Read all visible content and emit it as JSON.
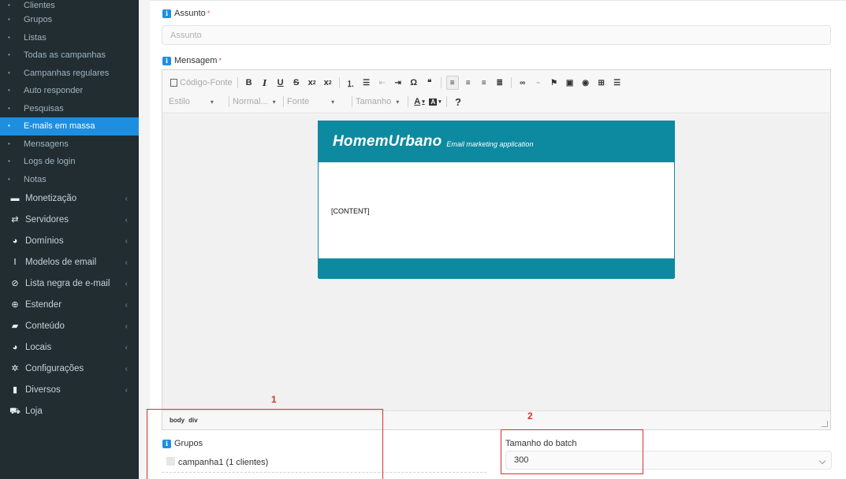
{
  "sidebar": {
    "sub_items": [
      {
        "label": "Clientes"
      },
      {
        "label": "Grupos"
      },
      {
        "label": "Listas"
      },
      {
        "label": "Todas as campanhas"
      },
      {
        "label": "Campanhas regulares"
      },
      {
        "label": "Auto responder"
      },
      {
        "label": "Pesquisas"
      },
      {
        "label": "E-mails em massa",
        "active": true
      },
      {
        "label": "Mensagens"
      },
      {
        "label": "Logs de login"
      },
      {
        "label": "Notas"
      }
    ],
    "main_items": [
      {
        "label": "Monetização",
        "icon": "credit-card-icon",
        "glyph": "▬",
        "chevron": "‹"
      },
      {
        "label": "Servidores",
        "icon": "exchange-icon",
        "glyph": "⇄",
        "chevron": "‹"
      },
      {
        "label": "Domínios",
        "icon": "globe-icon",
        "glyph": "◕",
        "chevron": "‹"
      },
      {
        "label": "Modelos de email",
        "icon": "text-height-icon",
        "glyph": "Ⅰ",
        "chevron": "‹"
      },
      {
        "label": "Lista negra de e-mail",
        "icon": "ban-icon",
        "glyph": "⊘",
        "chevron": "‹"
      },
      {
        "label": "Estender",
        "icon": "plus-circle-icon",
        "glyph": "⊕",
        "chevron": "‹"
      },
      {
        "label": "Conteúdo",
        "icon": "folder-open-icon",
        "glyph": "▰",
        "chevron": "‹"
      },
      {
        "label": "Locais",
        "icon": "globe-icon",
        "glyph": "◕",
        "chevron": "‹"
      },
      {
        "label": "Configurações",
        "icon": "cogs-icon",
        "glyph": "✲",
        "chevron": "‹"
      },
      {
        "label": "Diversos",
        "icon": "bookmark-icon",
        "glyph": "▮",
        "chevron": "‹"
      },
      {
        "label": "Loja",
        "icon": "shopping-cart-icon",
        "glyph": "⛟",
        "chevron": ""
      }
    ]
  },
  "form": {
    "subject": {
      "label": "Assunto",
      "required_mark": "*",
      "placeholder": "Assunto"
    },
    "message": {
      "label": "Mensagem",
      "required_mark": "*"
    },
    "info_glyph": "i"
  },
  "editor": {
    "source_button": "Código-Fonte",
    "style_combo": "Estilo",
    "format_combo": "Normal...",
    "font_combo": "Fonte",
    "size_combo": "Tamanho",
    "help_button": "?",
    "combo_arrow": "▾",
    "statusbar_path": [
      "body",
      "div"
    ],
    "email": {
      "brand": "HomemUrbano",
      "tagline": "Email marketing application",
      "content_placeholder": "[CONTENT]"
    }
  },
  "groups": {
    "label": "Grupos",
    "items": [
      {
        "label": "campanha1 (1 clientes)"
      }
    ]
  },
  "batch": {
    "label": "Tamanho do batch",
    "value": "300"
  },
  "annotations": {
    "first": "1",
    "second": "2"
  },
  "colors": {
    "sidebar_bg": "#222d32",
    "active": "#1e8fe0",
    "email_brand": "#0e8aa0",
    "annotation": "#d9302c"
  }
}
